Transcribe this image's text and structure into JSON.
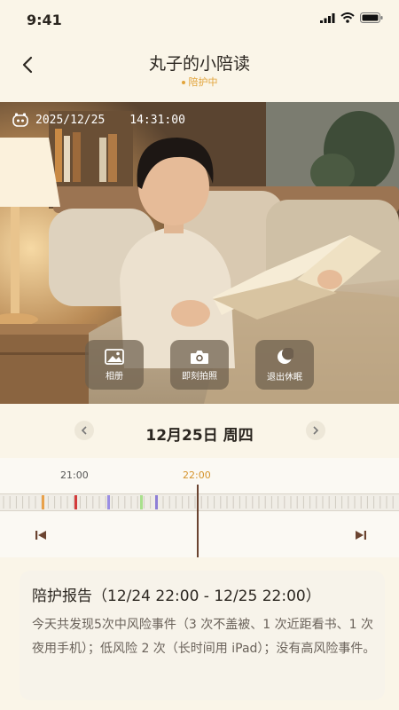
{
  "status_bar": {
    "time": "9:41"
  },
  "nav": {
    "title": "丸子的小陪读",
    "status": "陪护中"
  },
  "camera": {
    "date": "2025/12/25",
    "time": "14:31:00",
    "controls": [
      {
        "icon": "image-icon",
        "label": "相册"
      },
      {
        "icon": "camera-icon",
        "label": "即刻拍照"
      },
      {
        "icon": "moon-icon",
        "label": "退出休眠"
      }
    ]
  },
  "date_nav": {
    "label": "12月25日 周四"
  },
  "timeline": {
    "labels": [
      "21:00",
      "22:00"
    ],
    "current": "22:00",
    "event_colors": [
      "#e8a14a",
      "#d33a3a",
      "#9a8ee3",
      "#a8e08c",
      "#8e7fd6"
    ]
  },
  "report": {
    "title": "陪护报告（12/24 22:00 - 12/25 22:00）",
    "body": "今天共发现5次中风险事件（3 次不盖被、1 次近距看书、1 次夜用手机）；低风险 2 次（长时间用 iPad）；没有高风险事件。"
  },
  "colors": {
    "accent": "#e2a43a",
    "background": "#faf5e8"
  }
}
